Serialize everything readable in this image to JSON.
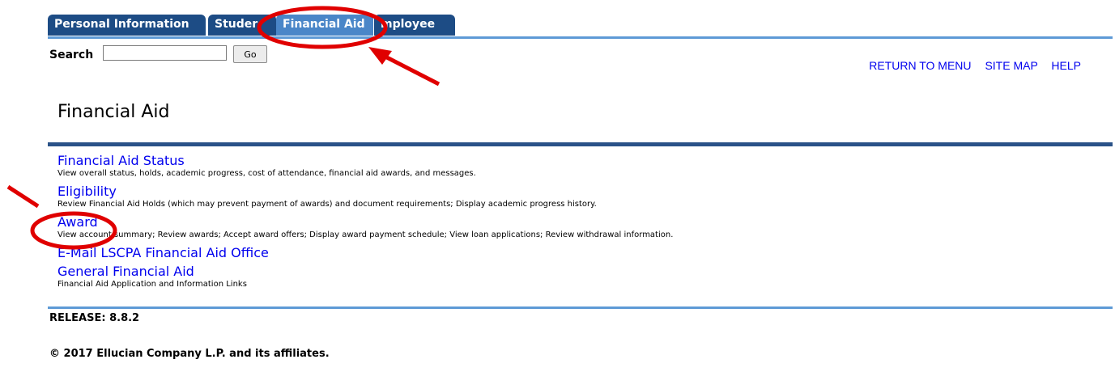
{
  "tabs": [
    {
      "label": "Personal Information"
    },
    {
      "label": "Studer"
    },
    {
      "label": "Financial Aid"
    },
    {
      "label": "mployee"
    }
  ],
  "search": {
    "label": "Search",
    "value": "",
    "button": "Go"
  },
  "top_links": [
    "RETURN TO MENU",
    "SITE MAP",
    "HELP"
  ],
  "page_title": "Financial Aid",
  "menu_items": [
    {
      "title": "Financial Aid Status",
      "description": "View overall status, holds, academic progress, cost of attendance, financial aid awards, and messages."
    },
    {
      "title": "Eligibility",
      "description": "Review Financial Aid Holds (which may prevent payment of awards) and document requirements; Display academic progress history."
    },
    {
      "title": "Award",
      "description": "View account summary; Review awards; Accept award offers; Display award payment schedule; View loan applications; Review withdrawal information."
    },
    {
      "title": "E-Mail LSCPA Financial Aid Office",
      "description": ""
    },
    {
      "title": "General Financial Aid",
      "description": "Financial Aid Application and Information Links"
    }
  ],
  "release": "RELEASE: 8.8.2",
  "copyright": "© 2017 Ellucian Company L.P. and its affiliates.",
  "colors": {
    "tab": "#1d4c85",
    "tab_active": "#4a86c8",
    "link": "#0000ee",
    "rule_dark": "#2a5288",
    "rule_light": "#5e9ad6",
    "annotation": "#e00000"
  }
}
